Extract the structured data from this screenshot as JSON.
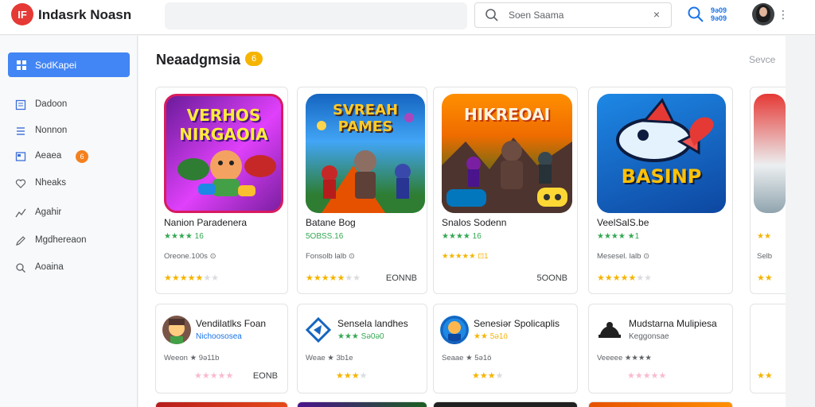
{
  "header": {
    "logo_text": "IF",
    "app_title": "Indasrk Noasn",
    "search_placeholder": "Soen Saama",
    "search_clear": "×",
    "ticker_line1": "9ə09",
    "ticker_line2": "9ə09",
    "kebab": "⋮"
  },
  "sidebar": {
    "active": {
      "label": "SodKapei",
      "icon": "home-icon"
    },
    "items": [
      {
        "label": "Dadoon",
        "icon": "list-icon"
      },
      {
        "label": "Nonnon",
        "icon": "menu-icon"
      },
      {
        "label": "Aeaea",
        "icon": "card-icon",
        "badge": "6"
      },
      {
        "label": "Nheaks",
        "icon": "heart-icon"
      },
      {
        "label": "Agahir",
        "icon": "chart-icon"
      },
      {
        "label": "Mgdhereaon",
        "icon": "edit-icon"
      },
      {
        "label": "Aoaina",
        "icon": "search-icon"
      }
    ]
  },
  "section": {
    "title": "Neaadgmsia",
    "badge": "6",
    "see_more": "Sevce"
  },
  "featured": [
    {
      "art_text": "VERHOS NIRGAOIA",
      "title": "Nanion Paradenera",
      "sub": "★★★★ 16",
      "meta": "Oreone.100s ⊙",
      "stars_on": 4,
      "stars_off": 2,
      "price": ""
    },
    {
      "art_text": "SVREAH PAMES",
      "title": "Batane Bog",
      "sub": "5OBSS.16",
      "meta": "Fonsolb lalb ⊙",
      "stars_on": 4,
      "stars_off": 2,
      "price": "EONNB"
    },
    {
      "art_text": "HIKREOAI",
      "title": "Snalos Sodenn",
      "sub": "★★★★ 16",
      "meta": "★★★★★ ⊡1",
      "stars_on": 0,
      "stars_off": 0,
      "price": "5OONB"
    },
    {
      "art_text": "BASINP",
      "title": "VeelSalS.be",
      "sub": "★★★★ ★1",
      "meta": "Mesesel. lalb ⊙",
      "stars_on": 4,
      "stars_off": 2,
      "price": ""
    },
    {
      "art_text": "",
      "title": "",
      "sub": "★★",
      "meta": "Selb",
      "stars_on": 2,
      "stars_off": 0,
      "price": ""
    }
  ],
  "apps": [
    {
      "title": "Vendilatlks Foan",
      "sub": "Nichoososea",
      "meta": "Weeon ★ 9ə11b",
      "stars_on": 0,
      "stars_off": 5,
      "price": "EONB"
    },
    {
      "title": "Sensela landhes",
      "sub": "★★★ Sə0ə0",
      "meta": "Weae ★ 3b1e",
      "stars_on": 3,
      "stars_off": 1,
      "price": ""
    },
    {
      "title": "Senesiər Spolicaplis",
      "sub": "★★ 5ə1ö",
      "meta": "Seaae ★ 5ə1ö",
      "stars_on": 3,
      "stars_off": 1,
      "price": ""
    },
    {
      "title": "Mudstarna Mulipiesa",
      "sub": "Keggonsae",
      "meta": "Veeeee ★★★★",
      "stars_on": 3,
      "stars_off": 2,
      "price": ""
    },
    {
      "title": "",
      "sub": "",
      "meta": "",
      "stars_on": 2,
      "stars_off": 0,
      "price": ""
    }
  ],
  "colors": {
    "accent": "#4285f4",
    "star": "#f5b400",
    "rating_green": "#34a853",
    "badge_orange": "#f4811f"
  }
}
